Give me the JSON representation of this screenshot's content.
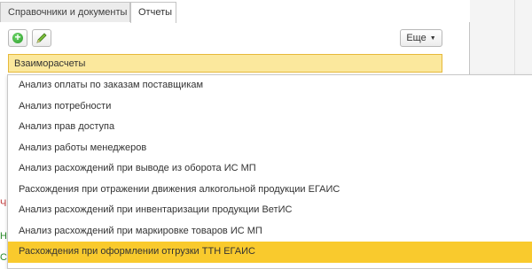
{
  "tabs": [
    {
      "label": "Справочники и документы",
      "active": false
    },
    {
      "label": "Отчеты",
      "active": true
    }
  ],
  "toolbar": {
    "add_icon": "add-circle-icon",
    "edit_icon": "pencil-icon",
    "more_label": "Еще",
    "more_icon": "chevron-down-icon"
  },
  "field": {
    "value": "Взаиморасчеты"
  },
  "colors": {
    "highlight": "#f9ca2d",
    "field_bg": "#fbe89d",
    "add_green": "#2b9a2b"
  },
  "left_partial": [
    "Ч",
    "Н",
    "С"
  ],
  "dropdown": {
    "items": [
      "Анализ оплаты по заказам поставщикам",
      "Анализ потребности",
      "Анализ прав доступа",
      "Анализ работы менеджеров",
      "Анализ расхождений при выводе из оборота ИС МП",
      "Расхождения при отражении движения алкогольной продукции ЕГАИС",
      "Анализ расхождений при инвентаризации продукции ВетИС",
      "Анализ расхождений при маркировке товаров ИС МП",
      "Расхождения при оформлении отгрузки ТТН ЕГАИС"
    ],
    "selected_index": 8
  }
}
